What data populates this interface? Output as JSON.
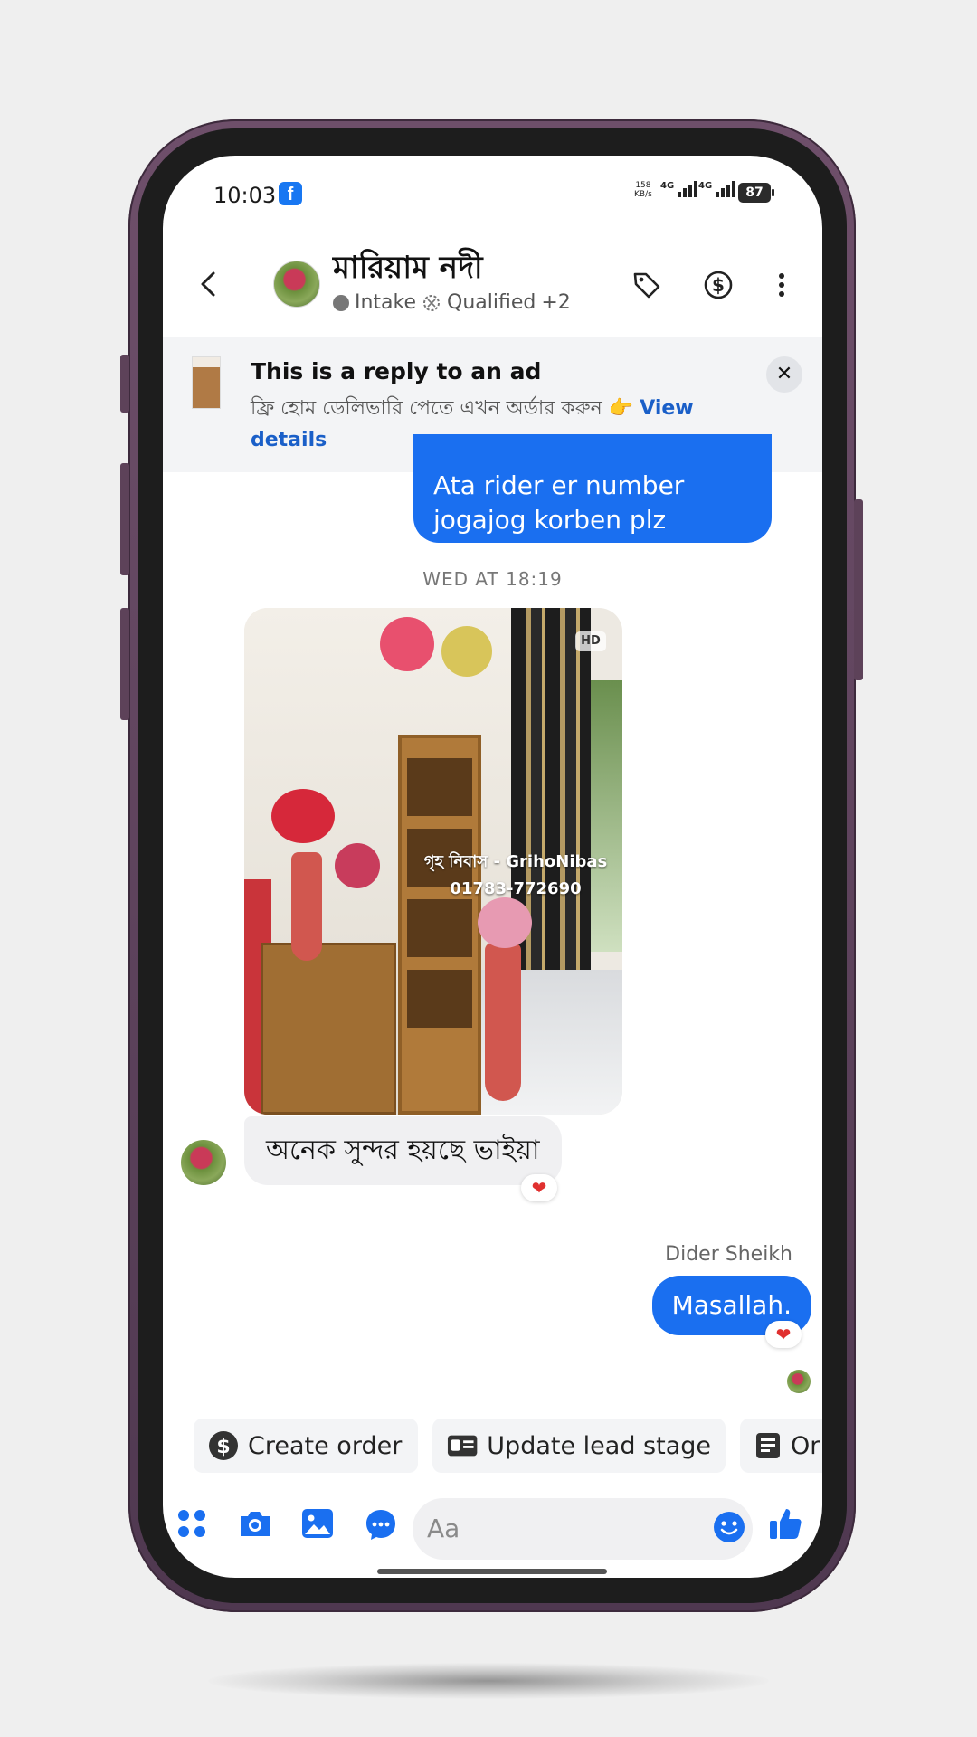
{
  "status_bar": {
    "time": "10:03",
    "app_badge": "f",
    "net_speed_value": "158",
    "net_speed_unit": "KB/s",
    "network_1": "4G",
    "network_2": "4G",
    "battery": "87"
  },
  "header": {
    "contact_name": "মারিয়াম নদী",
    "stage_1": "Intake",
    "stage_2": "Qualified",
    "more_tags": "+2"
  },
  "ad_banner": {
    "title": "This is a reply to an ad",
    "text": "ফ্রি হোম ডেলিভারি পেতে এখন অর্ডার করুন 👉",
    "link": "View details",
    "close": "✕"
  },
  "messages": {
    "outgoing_top": "Ata rider er number jogajog korben plz",
    "timestamp": "WED AT 18:19",
    "photo_badge": "HD",
    "photo_watermark_line1": "গৃহ নিবাস - GrihoNibas",
    "photo_watermark_line2": "01783-772690",
    "incoming_text": "অনেক সুন্দর হয়ছে ভাইয়া",
    "incoming_reaction": "❤",
    "sender_label": "Dider Sheikh",
    "outgoing_last": "Masallah.",
    "outgoing_reaction": "❤"
  },
  "quick_actions": [
    {
      "label": "Create order",
      "icon": "dollar-circle-icon"
    },
    {
      "label": "Update lead stage",
      "icon": "id-card-icon"
    },
    {
      "label": "Or",
      "icon": "order-list-icon"
    }
  ],
  "composer": {
    "placeholder": "Aa",
    "icons": [
      "apps-icon",
      "camera-icon",
      "gallery-icon",
      "chat-bubble-icon",
      "emoji-icon",
      "thumbs-up-icon"
    ]
  },
  "colors": {
    "accent": "#1a6ff0",
    "phone_frame": "#5d4259",
    "reaction": "#e0302f"
  }
}
